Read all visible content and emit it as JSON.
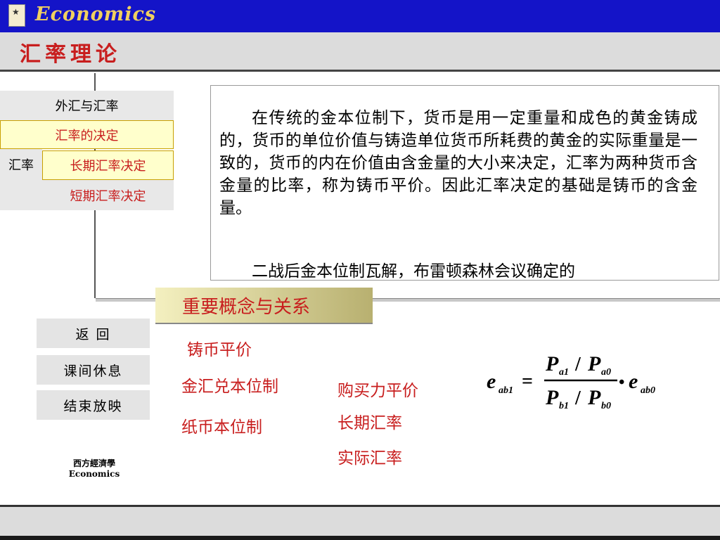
{
  "header": {
    "brand": "Economics",
    "title": "汇率理论"
  },
  "nav": {
    "item1": "外汇与汇率",
    "item2": "汇率的决定",
    "item3_prefix": "汇率",
    "item3": "长期汇率决定",
    "item4": "短期汇率决定"
  },
  "content": {
    "para1": "在传统的金本位制下，货币是用一定重量和成色的黄金铸成的，货币的单位价值与铸造单位货币所耗费的黄金的实际重量是一致的，货币的内在价值由含金量的大小来决定，汇率为两种货币含金量的比率，称为铸币平价。因此汇率决定的基础是铸币的含金量。",
    "para2": "二战后金本位制瓦解，布雷顿森林会议确定的"
  },
  "concepts": {
    "banner": "重要概念与关系",
    "terms": [
      "铸币平价",
      "金汇兑本位制",
      "纸币本位制",
      "购买力平价",
      "长期汇率",
      "实际汇率"
    ]
  },
  "buttons": {
    "back": "返  回",
    "break": "课间休息",
    "end": "结束放映"
  },
  "formula": {
    "lhs": "e",
    "lhs_sub": "ab1",
    "eq": "=",
    "num_a": "P",
    "num_a_sub": "a1",
    "num_slash": "/",
    "num_b": "P",
    "num_b_sub": "a0",
    "den_a": "P",
    "den_a_sub": "b1",
    "den_slash": "/",
    "den_b": "P",
    "den_b_sub": "b0",
    "dot": "•",
    "rhs": "e",
    "rhs_sub": "ab0"
  },
  "footer": {
    "cn": "西方經濟學",
    "en": "Economics"
  },
  "colors": {
    "accent_red": "#c81e1e",
    "top_bar": "#1414c8",
    "brand_gold": "#f0d060"
  }
}
